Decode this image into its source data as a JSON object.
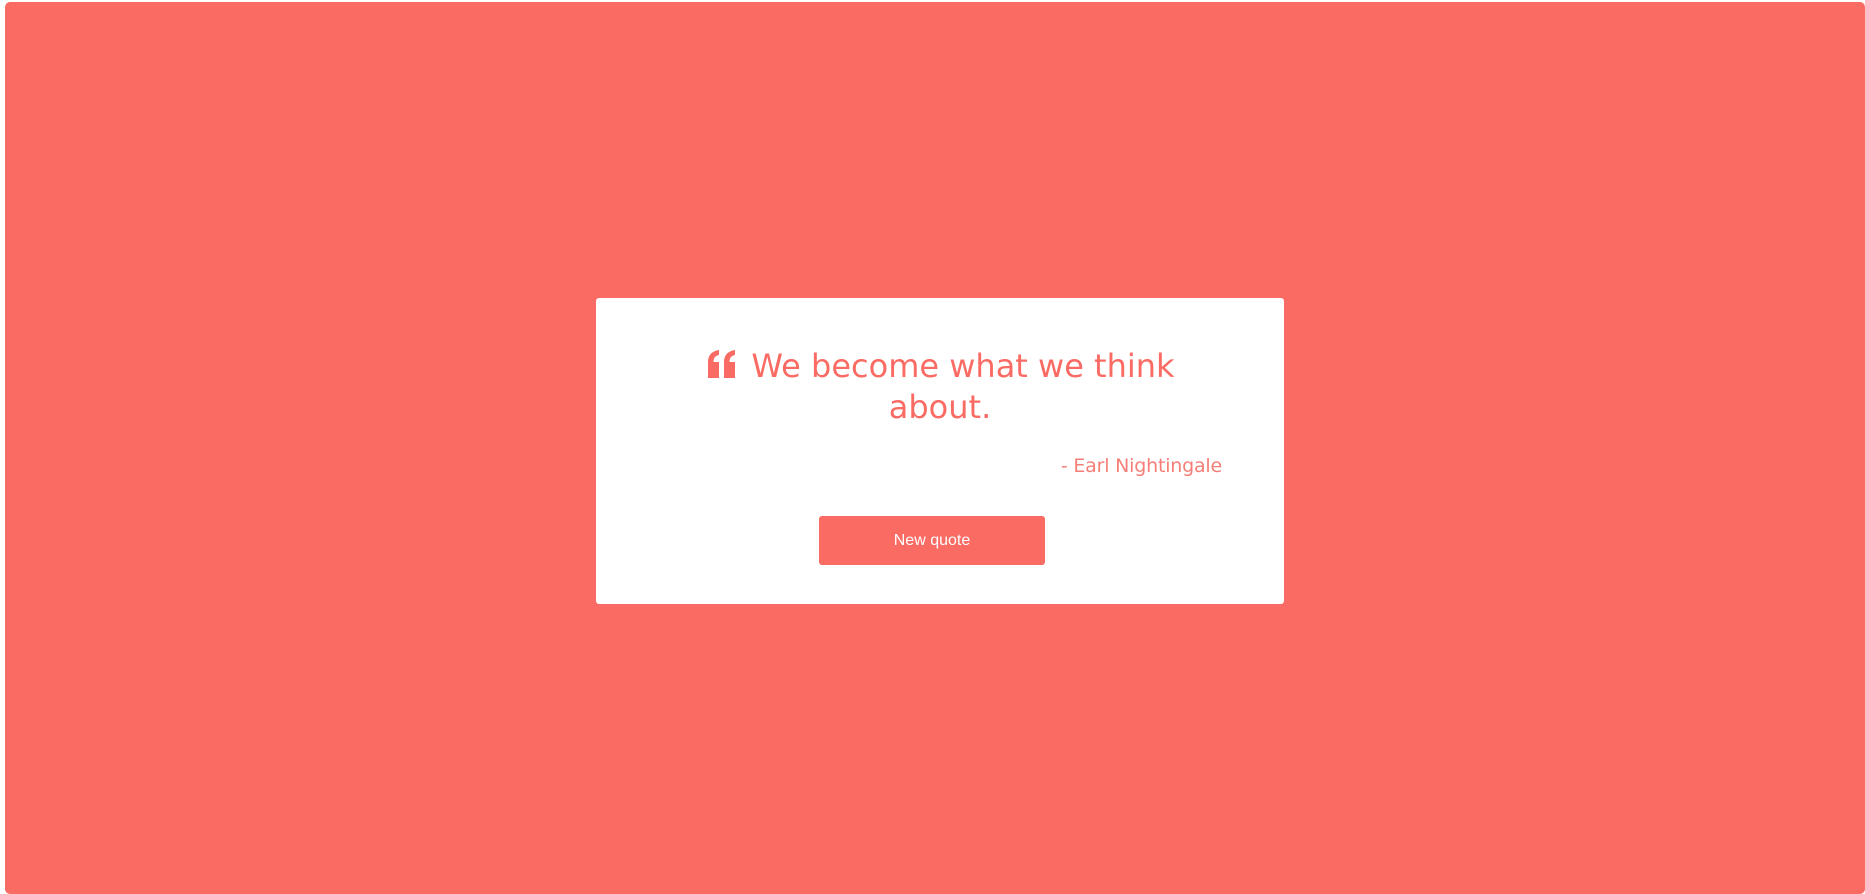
{
  "theme": {
    "background_color": "#fa6b64",
    "card_color": "#ffffff",
    "text_color": "#fa6b64"
  },
  "quote": {
    "text": "We become what we think about.",
    "icon": "quote-left-icon",
    "author": "- Earl Nightingale"
  },
  "actions": {
    "new_quote_label": "New quote"
  }
}
